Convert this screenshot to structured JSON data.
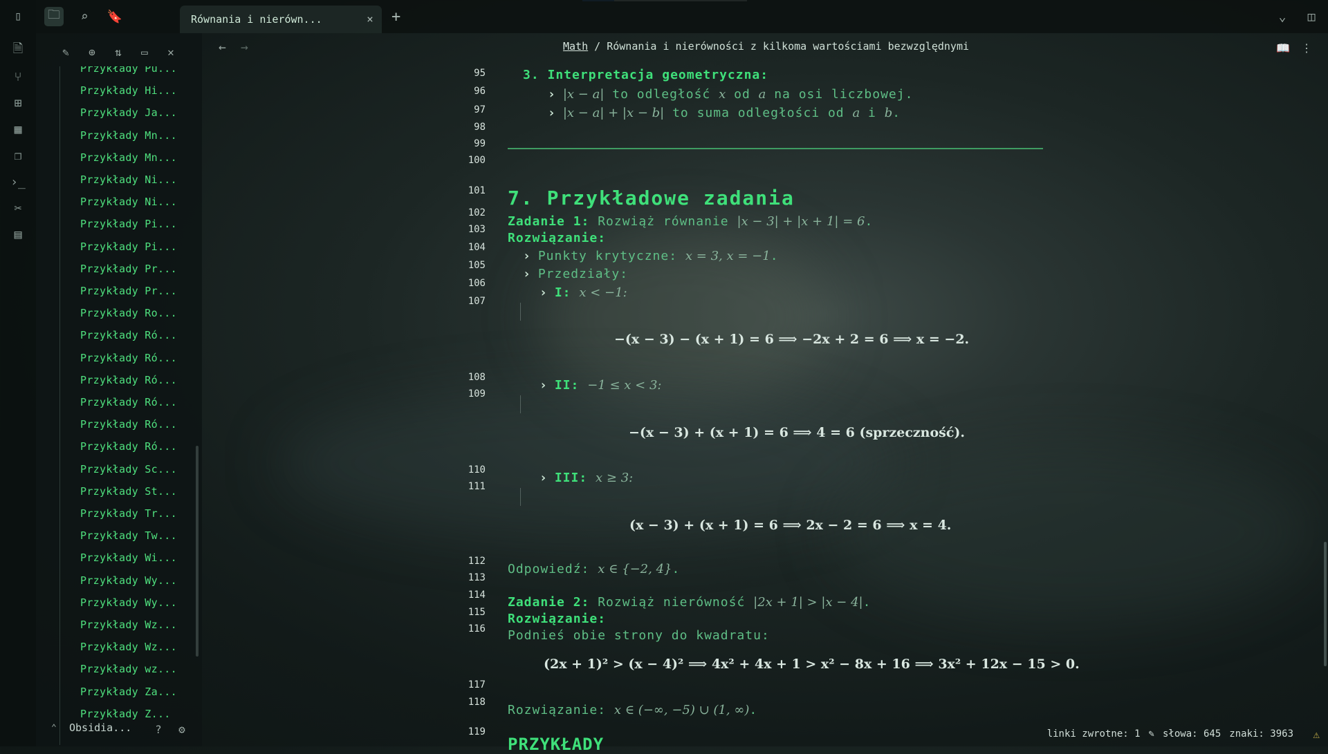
{
  "tab": {
    "title": "Równania i nierówn...",
    "close": "×",
    "new": "+"
  },
  "breadcrumb": {
    "folder": "Math",
    "sep": "/",
    "note": "Równania i nierówności z kilkoma wartościami bezwzględnymi"
  },
  "sidebar": {
    "items": [
      "Przykłady Pu...",
      "Przykłady Hi...",
      "Przykłady Ja...",
      "Przykłady Mn...",
      "Przykłady Mn...",
      "Przykłady Ni...",
      "Przykłady Ni...",
      "Przykłady Pi...",
      "Przykłady Pi...",
      "Przykłady Pr...",
      "Przykłady Pr...",
      "Przykłady Ro...",
      "Przykłady Ró...",
      "Przykłady Ró...",
      "Przykłady Ró...",
      "Przykłady Ró...",
      "Przykłady Ró...",
      "Przykłady Ró...",
      "Przykłady Sc...",
      "Przykłady St...",
      "Przykłady Tr...",
      "Przykłady Tw...",
      "Przykłady Wi...",
      "Przykłady Wy...",
      "Przykłady Wy...",
      "Przykłady Wz...",
      "Przykłady Wz...",
      "Przykłady wz...",
      "Przykłady Za...",
      "Przykłady Z..."
    ],
    "vault": "Obsidia..."
  },
  "editor": {
    "line_numbers": [
      "95",
      "96",
      "97",
      "98",
      "99",
      "100",
      "101",
      "102",
      "103",
      "104",
      "105",
      "106",
      "107",
      "108",
      "109",
      "110",
      "111",
      "112",
      "113",
      "114",
      "115",
      "116",
      "117",
      "118",
      "119"
    ],
    "l95_heading": "3. Interpretacja geometryczna:",
    "l96_math": "|x − a|",
    "l96_text": " to odległość ",
    "l96_x": "x",
    "l96_text2": " od ",
    "l96_a": "a",
    "l96_text3": " na osi liczbowej.",
    "l97_math": "|x − a| + |x − b|",
    "l97_text": " to suma odległości od ",
    "l97_a": "a",
    "l97_i": " i ",
    "l97_b": "b",
    "l97_dot": ".",
    "h7": "7. Przykładowe zadania",
    "z1_label": "Zadanie 1:",
    "z1_text": " Rozwiąż równanie ",
    "z1_math": "|x − 3| + |x + 1| = 6",
    "z1_dot": ".",
    "rozw": "Rozwiązanie:",
    "pk_text": "Punkty krytyczne: ",
    "pk_math": "x = 3, x = −1",
    "pk_dot": ".",
    "przedzialy": "Przedziały:",
    "i_label": "I:",
    "i_math": "x < −1:",
    "i_display": "−(x − 3) − (x + 1) = 6  ⟹  −2x + 2 = 6  ⟹  x = −2.",
    "ii_label": "II:",
    "ii_math": "−1 ≤ x < 3:",
    "ii_display": "−(x − 3) + (x + 1) = 6  ⟹  4 = 6   (sprzeczność).",
    "iii_label": "III:",
    "iii_math": "x ≥ 3:",
    "iii_display": "(x − 3) + (x + 1) = 6  ⟹  2x − 2 = 6  ⟹  x = 4.",
    "odp_text": "Odpowiedź: ",
    "odp_math": "x ∈ {−2, 4}",
    "odp_dot": ".",
    "z2_label": "Zadanie 2:",
    "z2_text": " Rozwiąż nierówność ",
    "z2_math": "|2x + 1| > |x − 4|",
    "z2_dot": ".",
    "rozw2": "Rozwiązanie:",
    "podnies": "Podnieś obie strony do kwadratu:",
    "z2_display": "(2x + 1)² > (x − 4)²  ⟹  4x² + 4x + 1 > x² − 8x + 16  ⟹  3x² + 12x − 15 > 0.",
    "rozw3_text": "Rozwiązanie: ",
    "rozw3_math": "x ∈ (−∞, −5) ∪ (1, ∞)",
    "rozw3_dot": ".",
    "l119": "PRZYKŁADY"
  },
  "status": {
    "backlinks": "linki zwrotne: 1",
    "words": "słowa: 645",
    "chars": "znaki: 3963"
  },
  "colors": {
    "accent": "#3fe07a",
    "text": "#5fbf86",
    "heading": "#3fe07a"
  }
}
